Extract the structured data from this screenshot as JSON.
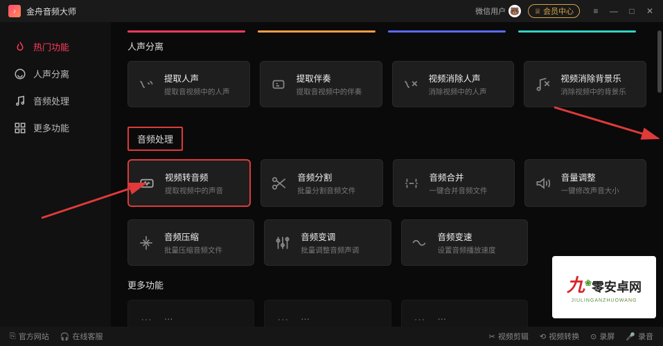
{
  "titlebar": {
    "app_name": "金舟音频大师",
    "user_label": "微信用户",
    "vip_label": "会员中心"
  },
  "sidebar": {
    "items": [
      {
        "label": "热门功能",
        "icon": "flame"
      },
      {
        "label": "人声分离",
        "icon": "headset"
      },
      {
        "label": "音频处理",
        "icon": "music"
      },
      {
        "label": "更多功能",
        "icon": "grid"
      }
    ]
  },
  "sections": {
    "voice_sep": {
      "title": "人声分离",
      "cards": [
        {
          "title": "提取人声",
          "desc": "提取音视频中的人声",
          "icon": "voice"
        },
        {
          "title": "提取伴奏",
          "desc": "提取音视频中的伴奏",
          "icon": "accomp"
        },
        {
          "title": "视频消除人声",
          "desc": "消除视频中的人声",
          "icon": "remove-voice"
        },
        {
          "title": "视频消除背景乐",
          "desc": "消除视频中的背景乐",
          "icon": "remove-bgm"
        }
      ]
    },
    "audio_proc": {
      "title": "音频处理",
      "row1": [
        {
          "title": "视频转音频",
          "desc": "提取视频中的声音",
          "icon": "wave",
          "highlight": true
        },
        {
          "title": "音频分割",
          "desc": "批量分割音频文件",
          "icon": "cut"
        },
        {
          "title": "音频合并",
          "desc": "一键合并音频文件",
          "icon": "merge"
        },
        {
          "title": "音量调整",
          "desc": "一键修改声音大小",
          "icon": "volume"
        }
      ],
      "row2": [
        {
          "title": "音频压缩",
          "desc": "批量压缩音频文件",
          "icon": "compress"
        },
        {
          "title": "音频变调",
          "desc": "批量调整音频声调",
          "icon": "tune"
        },
        {
          "title": "音频变速",
          "desc": "设置音频播放速度",
          "icon": "speed"
        }
      ]
    },
    "more": {
      "title": "更多功能"
    }
  },
  "footer": {
    "left": [
      {
        "label": "官方网站",
        "icon": "globe"
      },
      {
        "label": "在线客服",
        "icon": "support"
      }
    ],
    "right": [
      {
        "label": "视频剪辑",
        "icon": "scissors"
      },
      {
        "label": "视频转换",
        "icon": "convert"
      },
      {
        "label": "录屏",
        "icon": "record"
      },
      {
        "label": "录音",
        "icon": "mic"
      }
    ]
  },
  "watermark": {
    "text": "零安卓网",
    "sub": "JIULINGANZHUOWANG"
  },
  "colors": {
    "accent": "#ff3b5c",
    "highlight_border": "#e03a3a"
  }
}
